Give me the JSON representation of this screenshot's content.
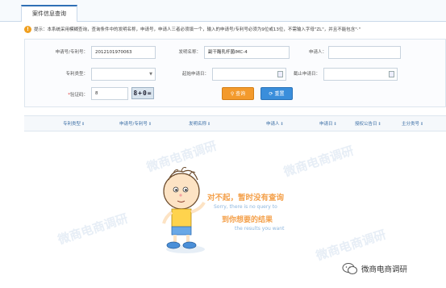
{
  "tabs": [
    {
      "label": "案件信息查询",
      "active": true
    }
  ],
  "notice": {
    "icon": "info-icon",
    "text": "提示：本系统采用模糊查询，查询条件中的发明名称，申请号，申请人三者必须填一个，输入的申请号/专利号必须为9位或13位，不需输入字母\"ZL\"，并且不能包含\"·\""
  },
  "form": {
    "application_no": {
      "label": "申请号/专利号：",
      "value": "2012101970063"
    },
    "invention_name": {
      "label": "发明名称：",
      "value": "副干酪乳杆菌IMC-4"
    },
    "applicant": {
      "label": "申请人：",
      "value": ""
    },
    "patent_type": {
      "label": "专利类型：",
      "value": ""
    },
    "start_date": {
      "label": "起始申请日：",
      "value": ""
    },
    "end_date": {
      "label": "截止申请日：",
      "value": ""
    },
    "captcha": {
      "label": "验证码：",
      "required_mark": "*",
      "value": "8",
      "image_text": "8+0="
    },
    "query_label": "查询",
    "reset_label": "重置"
  },
  "table": {
    "columns": [
      "专利类型",
      "申请号/专利号",
      "发明名称",
      "申请人",
      "申请日",
      "授权公告日",
      "主分类号"
    ],
    "sort_icon": "sort-icon"
  },
  "empty": {
    "line1": "对不起，暂时没有查询",
    "line2": "Sorry, there is no query to",
    "line3": "到你想要的结果",
    "line4": "the results you want"
  },
  "watermark": "微商电商调研",
  "colors": {
    "accent": "#2f6fb5",
    "query": "#f39a2c",
    "reset": "#3a8edb",
    "empty_text": "#f4a04a"
  }
}
